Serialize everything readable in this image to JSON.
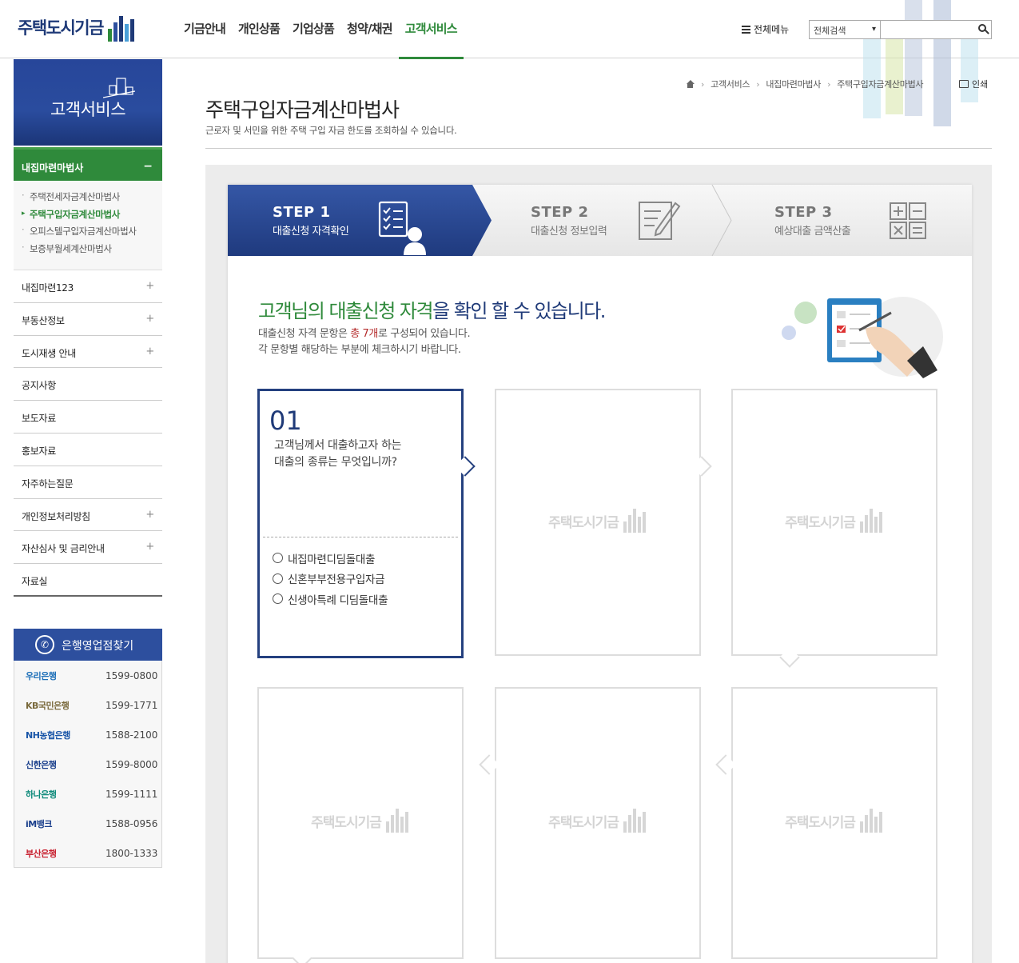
{
  "header": {
    "logo_text": "주택도시기금",
    "nav": [
      "기금안내",
      "개인상품",
      "기업상품",
      "청약/채권",
      "고객서비스"
    ],
    "all_menu_label": "전체메뉴",
    "search_select": "전체검색",
    "search_placeholder": ""
  },
  "sidebar": {
    "title": "고객서비스",
    "active_group": "내집마련마법사",
    "sub_items": [
      "주택전세자금계산마법사",
      "주택구입자금계산마법사",
      "오피스텔구입자금계산마법사",
      "보증부월세계산마법사"
    ],
    "menu_items": [
      {
        "label": "내집마련123",
        "plus": "+"
      },
      {
        "label": "부동산정보",
        "plus": "+"
      },
      {
        "label": "도시재생 안내",
        "plus": "+"
      },
      {
        "label": "공지사항",
        "plus": ""
      },
      {
        "label": "보도자료",
        "plus": ""
      },
      {
        "label": "홍보자료",
        "plus": ""
      },
      {
        "label": "자주하는질문",
        "plus": ""
      },
      {
        "label": "개인정보처리방침",
        "plus": "+"
      },
      {
        "label": "자산심사 및 금리안내",
        "plus": "+"
      },
      {
        "label": "자료실",
        "plus": ""
      }
    ],
    "bank_title": "은행영업점찾기",
    "banks": [
      {
        "name": "우리은행",
        "tel": "1599-0800",
        "color": "#1d6fb8"
      },
      {
        "name": "KB국민은행",
        "tel": "1599-1771",
        "color": "#7a6a3c"
      },
      {
        "name": "NH농협은행",
        "tel": "1588-2100",
        "color": "#1a56a8"
      },
      {
        "name": "신한은행",
        "tel": "1599-8000",
        "color": "#1a3f8c"
      },
      {
        "name": "하나은행",
        "tel": "1599-1111",
        "color": "#0e8a7a"
      },
      {
        "name": "iM뱅크",
        "tel": "1588-0956",
        "color": "#1a3f8c"
      },
      {
        "name": "부산은행",
        "tel": "1800-1333",
        "color": "#c8202f"
      }
    ]
  },
  "breadcrumb": [
    "고객서비스",
    "내집마련마법사",
    "주택구입자금계산마법사"
  ],
  "print_label": "인쇄",
  "page": {
    "title": "주택구입자금계산마법사",
    "desc": "근로자 및 서민을 위한 주택 구입 자금 한도를 조회하실 수 있습니다."
  },
  "steps": [
    {
      "label": "STEP 1",
      "sub": "대출신청 자격확인"
    },
    {
      "label": "STEP 2",
      "sub": "대출신청 정보입력"
    },
    {
      "label": "STEP 3",
      "sub": "예상대출 금액산출"
    }
  ],
  "intro": {
    "title_green": "고객님의 대출신청 자격",
    "title_rest": "을 확인 할 수 있습니다.",
    "desc1_a": "대출신청 자격 문항은 ",
    "desc1_red": "총 7개",
    "desc1_b": "로 구성되어 있습니다.",
    "desc2": "각 문항별 해당하는 부분에 체크하시기 바랍니다."
  },
  "question": {
    "num": "01",
    "line1": "고객님께서 대출하고자 하는",
    "line2": "대출의 종류는 무엇입니까?",
    "options": [
      "내집마련디딤돌대출",
      "신혼부부전용구입자금",
      "신생아특례 디딤돌대출"
    ]
  },
  "watermark": "주택도시기금",
  "colors": {
    "primary": "#24407f",
    "accent": "#2f8a3b"
  }
}
